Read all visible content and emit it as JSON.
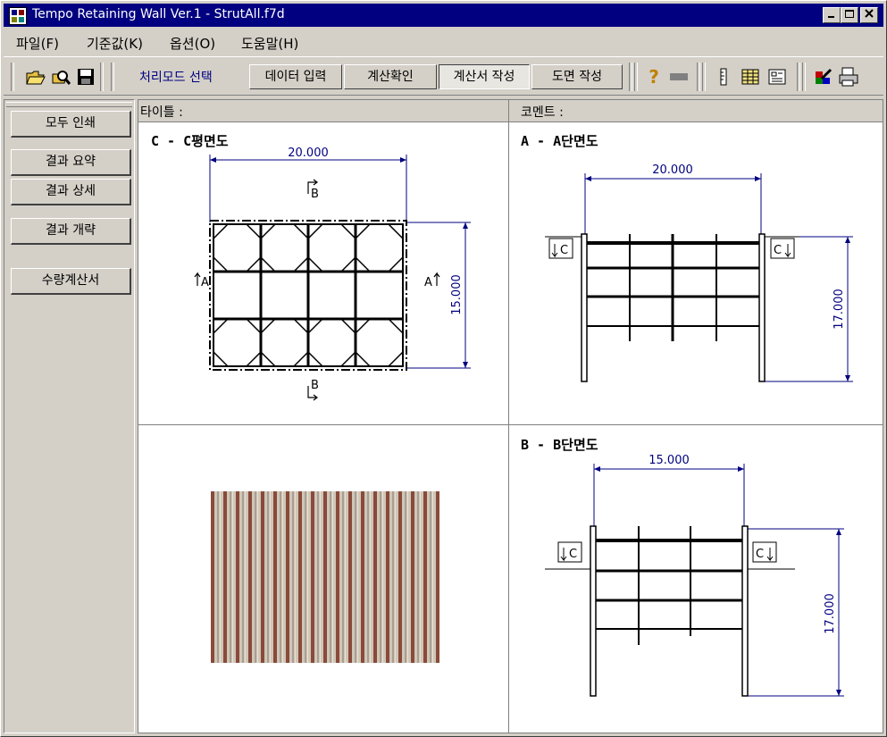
{
  "window": {
    "title": "Tempo Retaining Wall Ver.1 - StrutAll.f7d",
    "min": "_",
    "max": "□",
    "close": "×"
  },
  "menu": [
    {
      "label": "파일(F)"
    },
    {
      "label": "기준값(K)"
    },
    {
      "label": "옵션(O)"
    },
    {
      "label": "도움말(H)"
    }
  ],
  "toolbar": {
    "mode_label": "처리모드 선택",
    "modes": [
      {
        "label": "데이터 입력"
      },
      {
        "label": "계산확인"
      },
      {
        "label": "계산서 작성"
      },
      {
        "label": "도면 작성"
      }
    ],
    "icons": [
      "open-folder-icon",
      "find-file-icon",
      "save-disk-icon",
      "help-icon",
      "gray-bar-icon",
      "ruler-icon",
      "table-grid-icon",
      "layout-icon",
      "palette-edit-icon",
      "print-icon"
    ]
  },
  "left_buttons": [
    {
      "label": "모두 인쇄"
    },
    {
      "label": "결과 요약"
    },
    {
      "label": "결과 상세"
    },
    {
      "label": "결과 개략"
    },
    {
      "label": "수량계산서"
    }
  ],
  "content": {
    "title_label": "타이틀 :",
    "comment_label": "코멘트 :"
  },
  "drawings": {
    "plan": {
      "title": "C - C평면도",
      "width": "20.000",
      "height": "15.000",
      "sec_a": "A",
      "sec_b": "B"
    },
    "section_a": {
      "title": "A - A단면도",
      "width": "20.000",
      "height": "17.000",
      "sec_c": "C"
    },
    "section_b": {
      "title": "B - B단면도",
      "width": "15.000",
      "height": "17.000",
      "sec_c": "C"
    }
  },
  "colors": {
    "titlebar": "#000080",
    "dim_line": "#000080",
    "face": "#d4d0c8"
  }
}
